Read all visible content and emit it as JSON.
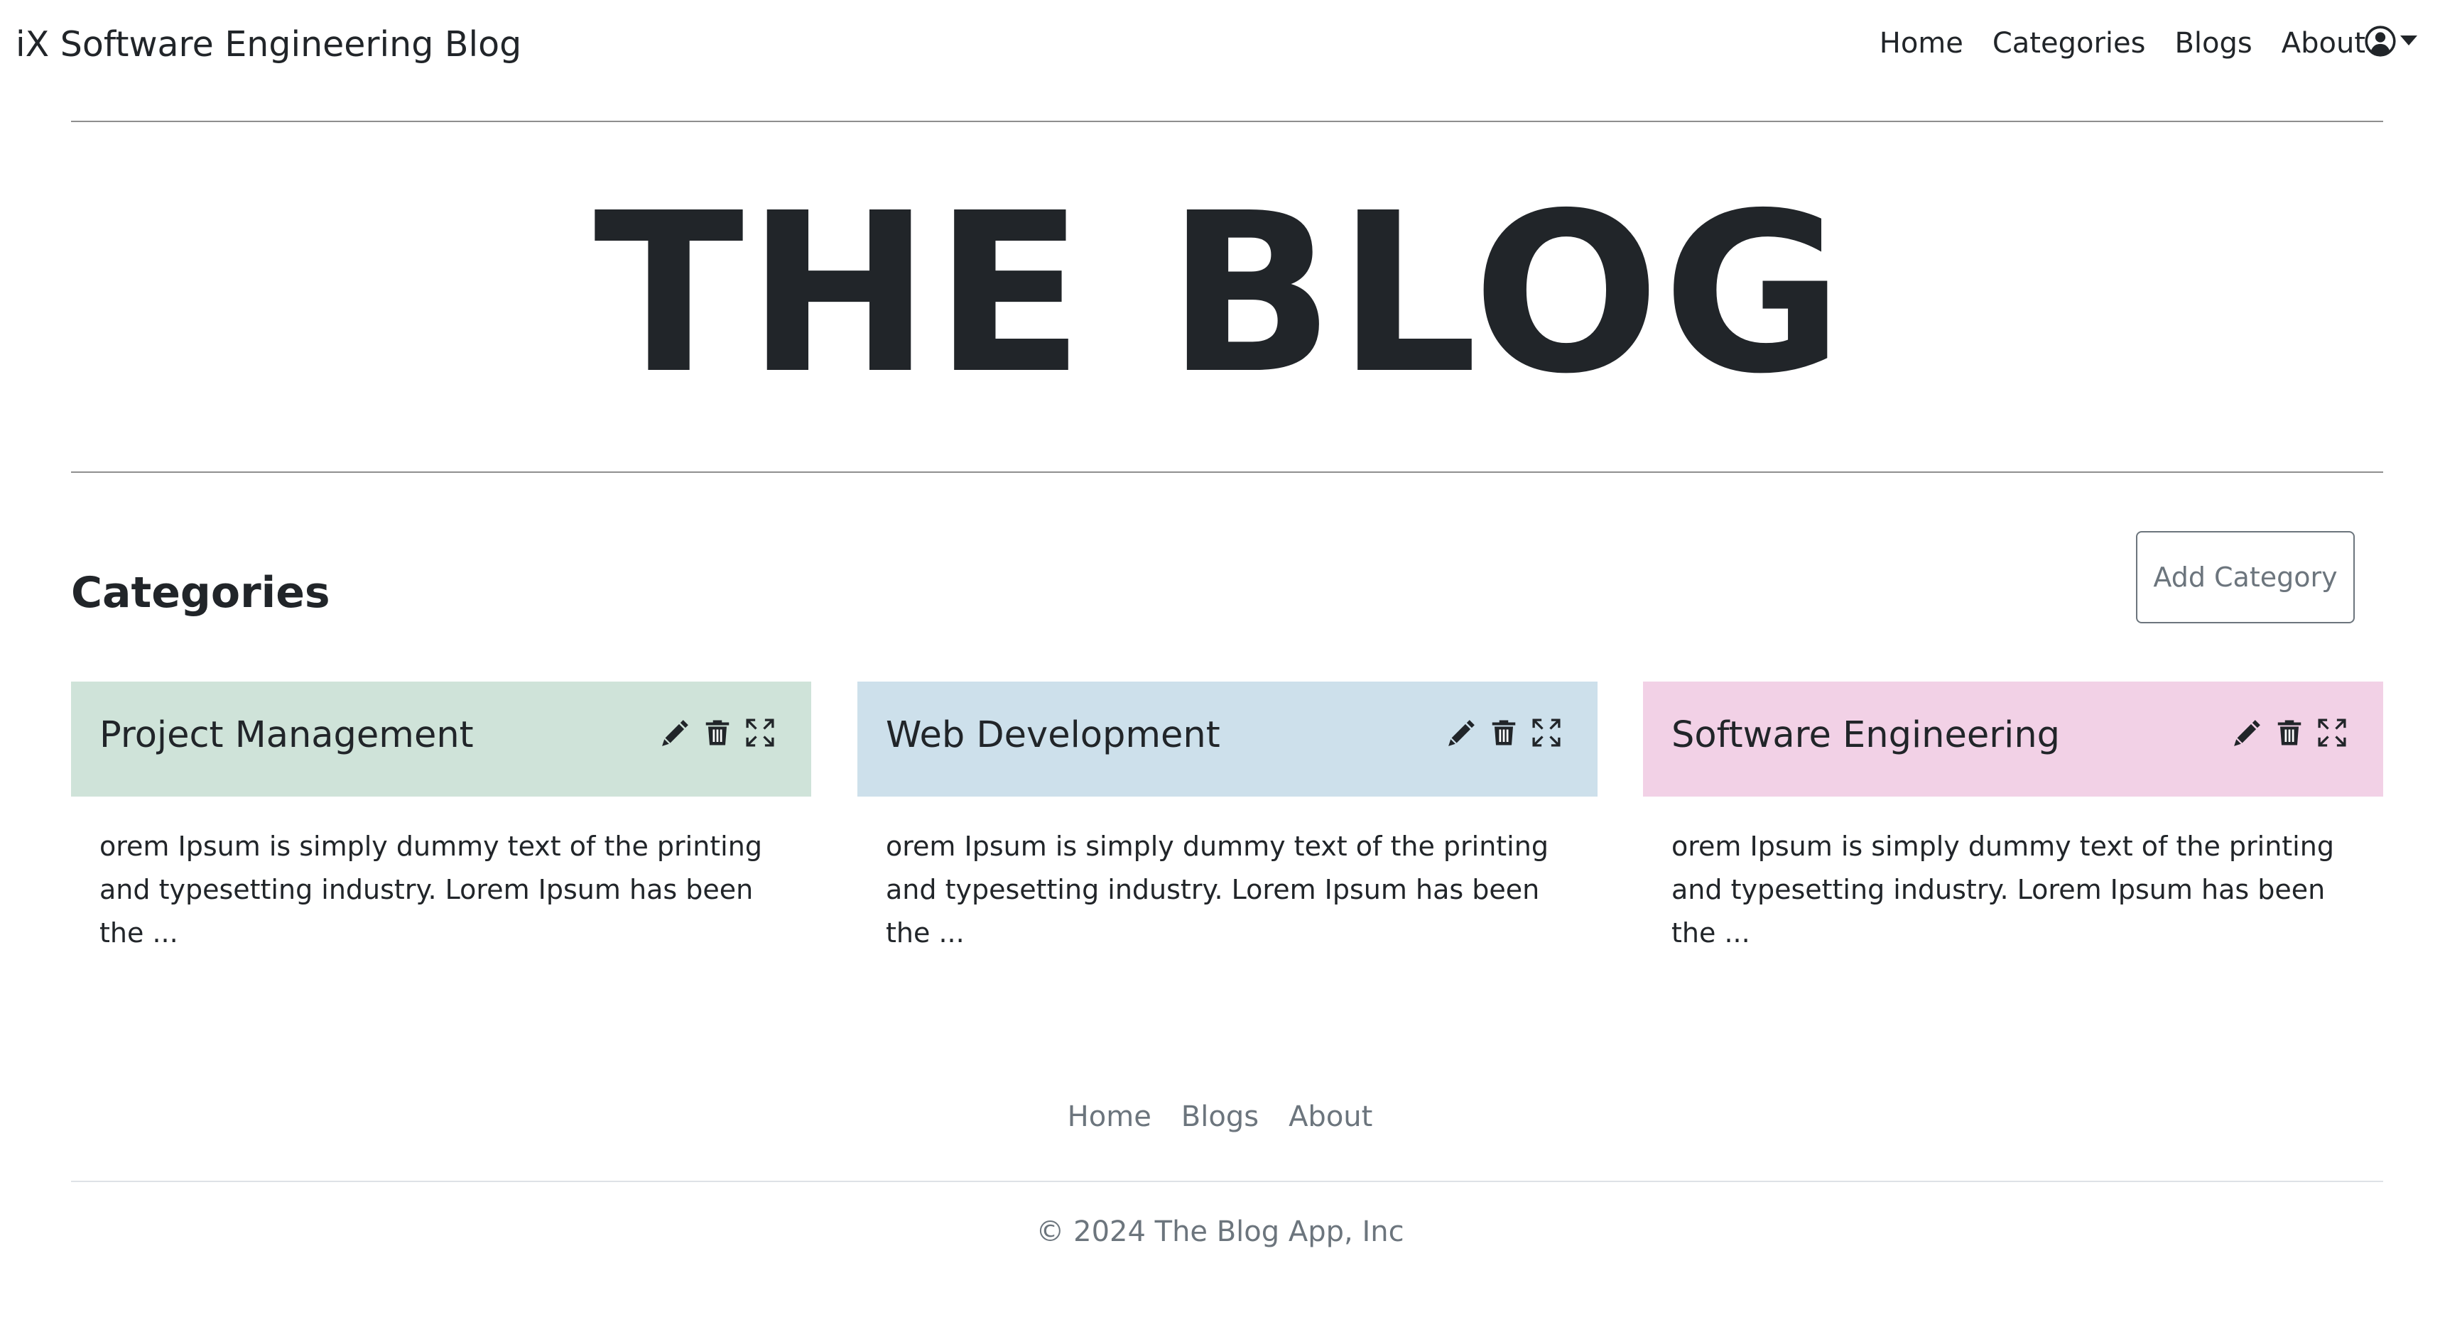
{
  "navbar": {
    "brand": "iX Software Engineering Blog",
    "links": [
      "Home",
      "Categories",
      "Blogs",
      "About"
    ],
    "user_icon": "user-circle-icon",
    "dropdown_icon": "caret-down-icon"
  },
  "hero": {
    "title": "THE BLOG"
  },
  "categories": {
    "heading": "Categories",
    "add_button_label": "Add Category",
    "cards": [
      {
        "title": "Project Management",
        "header_color": "#cfe3d9",
        "description": "orem Ipsum is simply dummy text of the printing and typesetting industry. Lorem Ipsum has been the ...",
        "icons": [
          "pencil-icon",
          "trash-icon",
          "expand-icon"
        ]
      },
      {
        "title": "Web Development",
        "header_color": "#cde0eb",
        "description": "orem Ipsum is simply dummy text of the printing and typesetting industry. Lorem Ipsum has been the ...",
        "icons": [
          "pencil-icon",
          "trash-icon",
          "expand-icon"
        ]
      },
      {
        "title": "Software Engineering",
        "header_color": "#f2d1e6",
        "description": "orem Ipsum is simply dummy text of the printing and typesetting industry. Lorem Ipsum has been the ...",
        "icons": [
          "pencil-icon",
          "trash-icon",
          "expand-icon"
        ]
      }
    ]
  },
  "footer": {
    "links": [
      "Home",
      "Blogs",
      "About"
    ],
    "copyright": "© 2024 The Blog App, Inc"
  },
  "colors": {
    "text": "#212529",
    "muted": "#6c757d",
    "divider": "#8f8f8f"
  }
}
